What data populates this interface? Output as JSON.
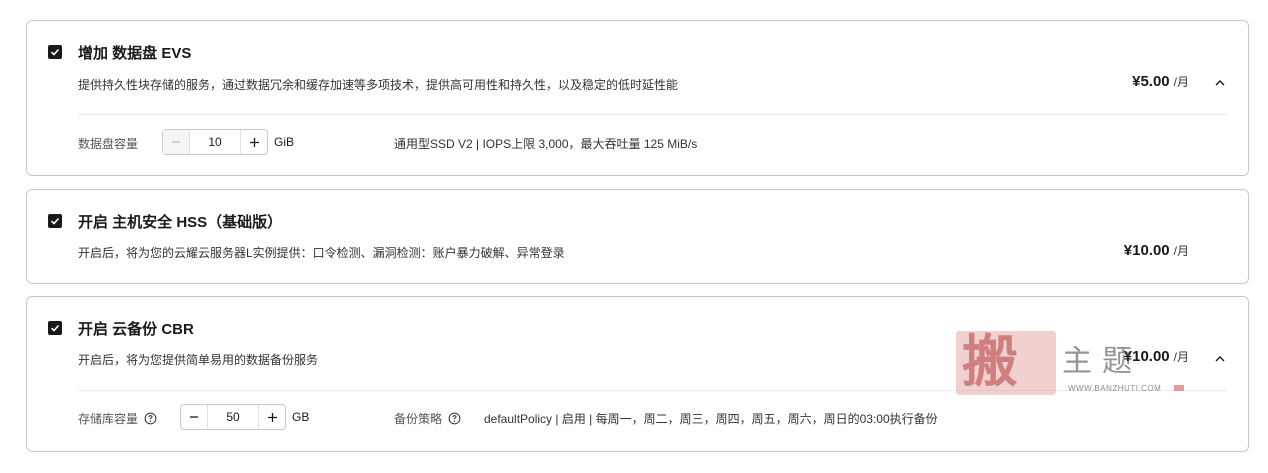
{
  "cards": [
    {
      "title": "增加 数据盘 EVS",
      "description": "提供持久性块存储的服务，通过数据冗余和缓存加速等多项技术，提供高可用性和持久性，以及稳定的低时延性能",
      "price": "¥5.00",
      "price_unit": "/月",
      "checked": true,
      "row": {
        "label": "数据盘容量",
        "value": "10",
        "unit": "GiB",
        "spec": "通用型SSD V2 | IOPS上限 3,000，最大吞吐量 125 MiB/s"
      }
    },
    {
      "title": "开启 主机安全 HSS（基础版）",
      "description": "开启后，将为您的云耀云服务器L实例提供：口令检测、漏洞检测：账户暴力破解、异常登录",
      "price": "¥10.00",
      "price_unit": "/月",
      "checked": true
    },
    {
      "title": "开启 云备份 CBR",
      "description": "开启后，将为您提供简单易用的数据备份服务",
      "price": "¥10.00",
      "price_unit": "/月",
      "checked": true,
      "row": {
        "label": "存储库容量",
        "value": "50",
        "unit": "GB",
        "policy_label": "备份策略",
        "spec": "defaultPolicy | 启用 | 每周一，周二，周三，周四，周五，周六，周日的03:00执行备份"
      }
    }
  ],
  "watermark": {
    "char": "搬",
    "text": "主题",
    "url": "WWW.BANZHUTI.COM"
  },
  "icons": {
    "checkbox": "check-icon",
    "collapse": "chevron-up-icon",
    "help": "question-circle-icon",
    "minus": "minus-icon",
    "plus": "plus-icon"
  }
}
